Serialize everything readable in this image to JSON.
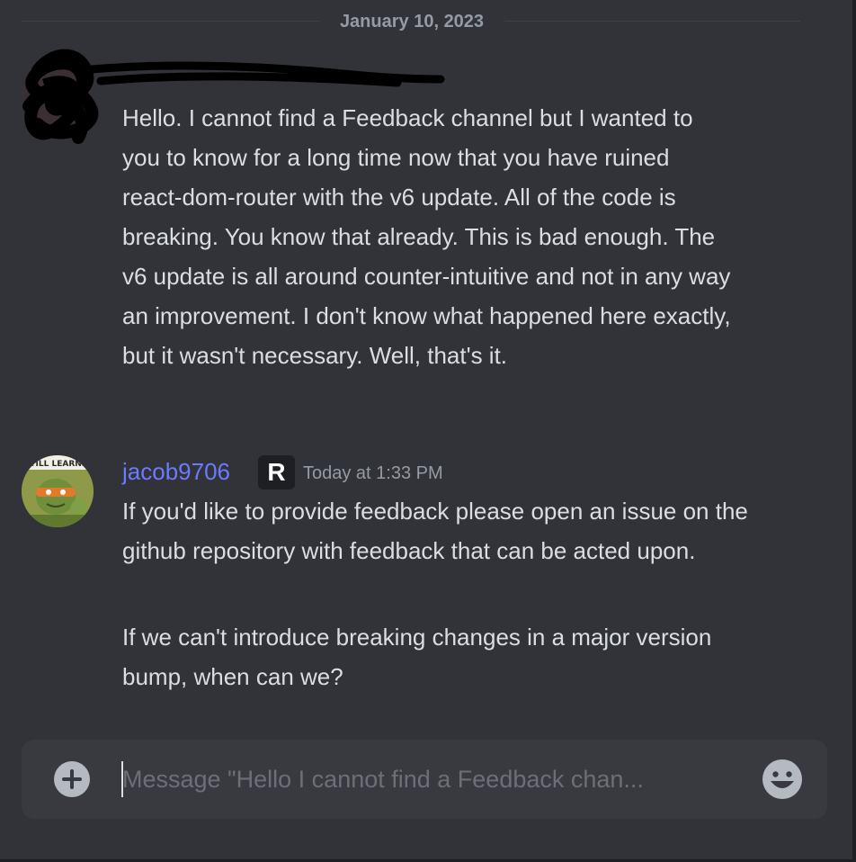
{
  "divider": {
    "date": "January 10, 2023"
  },
  "messages": [
    {
      "author": "",
      "avatar_redacted": true,
      "text": "Hello. I cannot find a Feedback channel but I wanted to you to know for a long time now that you have ruined react-dom-router with the v6 update. All of the code is breaking. You know that already. This is bad enough. The v6 update is all around counter-intuitive and not in any way an improvement. I don't know what happened here exactly, but it wasn't necessary. Well, that's it."
    },
    {
      "author": "jacob9706",
      "badge_icon": "remix-r-icon",
      "badge": "R",
      "timestamp": "Today at 1:33 PM",
      "avatar_caption": "STILL LEARN...",
      "paragraphs": [
        "If you'd like to provide feedback please open an issue on the github repository with feedback that can be acted upon.",
        "If we can't introduce breaking changes in a major version bump, when can we?"
      ]
    }
  ],
  "composer": {
    "placeholder": "Message \"Hello I cannot find a Feedback chan...",
    "add_icon": "plus-circle-icon",
    "emoji_icon": "smiley-icon"
  },
  "colors": {
    "background": "#313338",
    "composer": "#383a40",
    "author_name": "#6b7bff",
    "text": "#dbdee1",
    "muted": "#949ba4"
  }
}
